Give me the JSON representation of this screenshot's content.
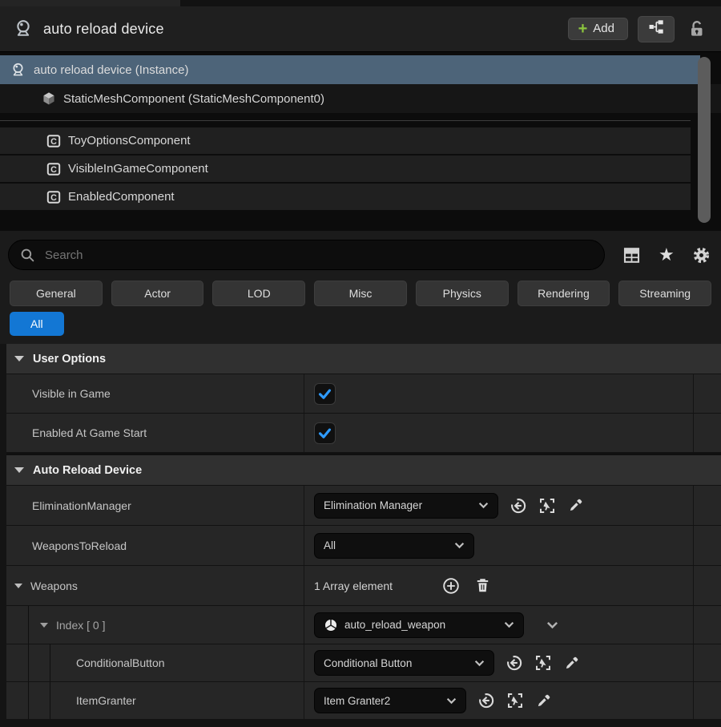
{
  "colors": {
    "accent_blue": "#1377d4",
    "check_blue": "#2e9bff",
    "add_green": "#8CC63E",
    "selected_row": "#4d6479"
  },
  "header": {
    "title": "auto reload device",
    "add_label": "Add"
  },
  "tree": {
    "selected_item": "auto reload device (Instance)",
    "child_item": "StaticMeshComponent (StaticMeshComponent0)",
    "components": [
      "ToyOptionsComponent",
      "VisibleInGameComponent",
      "EnabledComponent"
    ]
  },
  "search": {
    "placeholder": "Search"
  },
  "filters": {
    "tabs": [
      "General",
      "Actor",
      "LOD",
      "Misc",
      "Physics",
      "Rendering",
      "Streaming"
    ],
    "all_label": "All"
  },
  "user_options": {
    "title": "User Options",
    "visible_in_game": {
      "label": "Visible in Game",
      "checked": true
    },
    "enabled_at_game_start": {
      "label": "Enabled At Game Start",
      "checked": true
    }
  },
  "auto_reload_device": {
    "title": "Auto Reload Device",
    "elimination_manager": {
      "label": "EliminationManager",
      "value": "Elimination Manager"
    },
    "weapons_to_reload": {
      "label": "WeaponsToReload",
      "value": "All"
    },
    "weapons": {
      "label": "Weapons",
      "value": "1 Array element"
    },
    "index0": {
      "label": "Index [ 0 ]",
      "value": "auto_reload_weapon"
    },
    "conditional_button": {
      "label": "ConditionalButton",
      "value": "Conditional Button"
    },
    "item_granter": {
      "label": "ItemGranter",
      "value": "Item Granter2"
    }
  }
}
